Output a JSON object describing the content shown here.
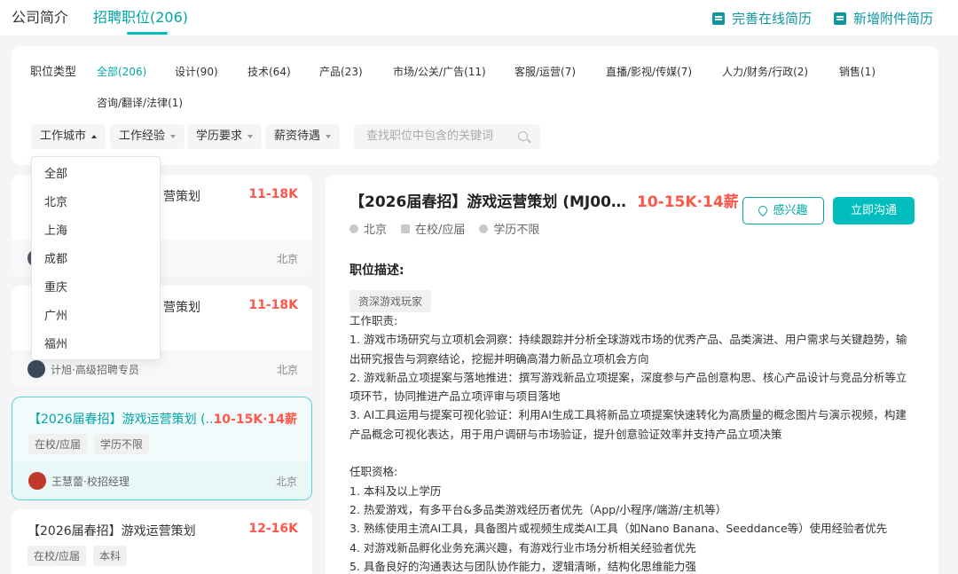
{
  "top": {
    "tabs": [
      "公司简介",
      "招聘职位(206)"
    ],
    "actions": [
      "完善在线简历",
      "新增附件简历"
    ]
  },
  "filters": {
    "label": "职位类型",
    "categories": [
      "全部(206)",
      "设计(90)",
      "技术(64)",
      "产品(23)",
      "市场/公关/广告(11)",
      "客服/运营(7)",
      "直播/影视/传媒(7)",
      "人力/财务/行政(2)",
      "销售(1)",
      "咨询/翻译/法律(1)"
    ],
    "dropdowns": [
      "工作城市",
      "工作经验",
      "学历要求",
      "薪资待遇"
    ],
    "search_placeholder": "查找职位中包含的关键词"
  },
  "city_menu": [
    "全部",
    "北京",
    "上海",
    "成都",
    "重庆",
    "广州",
    "福州"
  ],
  "jobs": [
    {
      "title": "营策划",
      "salary": "11-18K",
      "tags": [],
      "recruiter": "",
      "city": "北京"
    },
    {
      "title": "营策划",
      "salary": "11-18K",
      "tags": [],
      "recruiter": "计旭·高级招聘专员",
      "city": "北京"
    },
    {
      "title": "【2026届春招】游戏运营策划 (...",
      "salary": "10-15K·14薪",
      "tags": [
        "在校/应届",
        "学历不限"
      ],
      "recruiter": "王慧蕾·校招经理",
      "city": "北京"
    },
    {
      "title": "【2026届春招】游戏运营策划",
      "salary": "12-16K",
      "tags": [
        "在校/应届",
        "本科"
      ],
      "recruiter": "",
      "city": ""
    }
  ],
  "detail": {
    "title": "【2026届春招】游戏运营策划 (MJ00...",
    "salary": "10-15K·14薪",
    "meta": [
      "北京",
      "在校/应届",
      "学历不限"
    ],
    "like_label": "感兴趣",
    "chat_label": "立即沟通",
    "section_title": "职位描述:",
    "tag": "资深游戏玩家",
    "lines": [
      "工作职责:",
      "1. 游戏市场研究与立项机会洞察：持续跟踪并分析全球游戏市场的优秀产品、品类演进、用户需求与关键趋势，输出研究报告与洞察结论，挖掘并明确高潜力新品立项机会方向",
      "2. 游戏新品立项提案与落地推进：撰写游戏新品立项提案，深度参与产品创意构思、核心产品设计与竞品分析等立项环节，协同推进产品立项评审与项目落地",
      "3. AI工具运用与提案可视化验证：利用AI生成工具将新品立项提案快速转化为高质量的概念图片与演示视频，构建产品概念可视化表达，用于用户调研与市场验证，提升创意验证效率并支持产品立项决策",
      "",
      "任职资格:",
      "1. 本科及以上学历",
      "2. 热爱游戏，有多平台&多品类游戏经历者优先（App/小程序/端游/主机等）",
      "3. 熟练使用主流AI工具，具备图片或视频生成类AI工具（如Nano Banana、Seeddance等）使用经验者优先",
      "4. 对游戏新品孵化业务充满兴趣，有游戏行业市场分析相关经验者优先",
      "5. 具备良好的沟通表达与团队协作能力，逻辑清晰，结构化思维能力强"
    ]
  }
}
